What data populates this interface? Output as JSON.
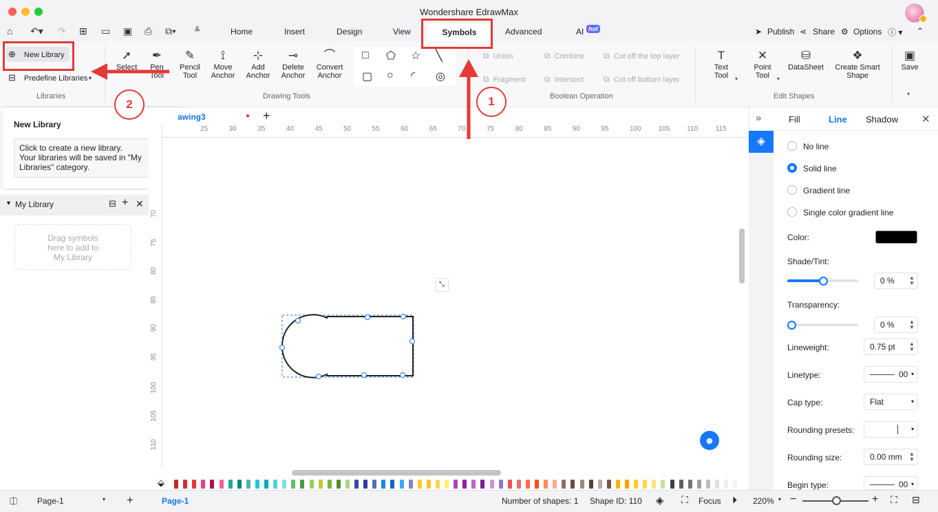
{
  "window": {
    "title": "Wondershare EdrawMax"
  },
  "menu": {
    "tabs": [
      "Home",
      "Insert",
      "Design",
      "View",
      "Symbols",
      "Advanced",
      "AI"
    ],
    "active_tab": "Symbols",
    "hot_badge": "hot",
    "right": {
      "publish": "Publish",
      "share": "Share",
      "options": "Options"
    }
  },
  "ribbon": {
    "libraries": {
      "new_library": "New Library",
      "predefine": "Predefine Libraries",
      "group_label": "Libraries"
    },
    "drawing_tools": {
      "select": "Select",
      "pen_line1": "Pen",
      "pen_line2": "Tool",
      "pencil_line1": "Pencil",
      "pencil_line2": "Tool",
      "move_line1": "Move",
      "move_line2": "Anchor",
      "add_line1": "Add",
      "add_line2": "Anchor",
      "delete_line1": "Delete",
      "delete_line2": "Anchor",
      "convert_line1": "Convert",
      "convert_line2": "Anchor",
      "group_label": "Drawing Tools"
    },
    "boolean": {
      "union": "Union",
      "combine": "Combine",
      "cut_top": "Cut off the top layer",
      "fragment": "Fragment",
      "intersect": "Intersect",
      "cut_bottom": "Cut off bottom layer",
      "group_label": "Boolean Operation"
    },
    "edit_shapes": {
      "text_line1": "Text",
      "text_line2": "Tool",
      "point_line1": "Point",
      "point_line2": "Tool",
      "datasheet": "DataSheet",
      "smart_line1": "Create Smart",
      "smart_line2": "Shape",
      "group_label": "Edit Shapes"
    },
    "save": "Save"
  },
  "popup": {
    "title": "New Library",
    "description": "Click to create a new library.\nYour libraries will be saved in \"My Libraries\" category."
  },
  "left_panel": {
    "my_library": "My Library",
    "drop_hint": "Drag symbols\nhere to add to\nMy Library"
  },
  "document": {
    "tab_name": "awing3"
  },
  "rulers": {
    "horizontal": [
      "25",
      "30",
      "35",
      "40",
      "45",
      "50",
      "55",
      "60",
      "65",
      "70",
      "75",
      "80",
      "85",
      "90",
      "95",
      "100",
      "105",
      "110",
      "115"
    ],
    "vertical": [
      "70",
      "75",
      "80",
      "85",
      "90",
      "95",
      "100",
      "105",
      "110"
    ]
  },
  "right_panel": {
    "tabs": {
      "fill": "Fill",
      "line": "Line",
      "shadow": "Shadow"
    },
    "active_tab": "Line",
    "line_options": [
      "No line",
      "Solid line",
      "Gradient line",
      "Single color gradient line"
    ],
    "selected_option": "Solid line",
    "color_label": "Color:",
    "color_value": "#000000",
    "shade_label": "Shade/Tint:",
    "shade_value": "0 %",
    "shade_fraction": 0.5,
    "transparency_label": "Transparency:",
    "transparency_value": "0 %",
    "transparency_fraction": 0.0,
    "lineweight_label": "Lineweight:",
    "lineweight_value": "0.75 pt",
    "linetype_label": "Linetype:",
    "linetype_value": "00",
    "cap_label": "Cap type:",
    "cap_value": "Flat",
    "rounding_presets_label": "Rounding presets:",
    "rounding_size_label": "Rounding size:",
    "rounding_size_value": "0.00 mm",
    "begin_type_label": "Begin type:",
    "begin_type_value": "00"
  },
  "status": {
    "page_select": "Page-1",
    "page_tab": "Page-1",
    "num_shapes": "Number of shapes: 1",
    "shape_id": "Shape ID: 110",
    "focus": "Focus",
    "zoom": "220%"
  },
  "annotations": {
    "step1": "1",
    "step2": "2"
  },
  "palette": [
    "#c62828",
    "#d32f2f",
    "#e53935",
    "#ec407a",
    "#ad1457",
    "#f06292",
    "#26a69a",
    "#00897b",
    "#4db6ac",
    "#26c6da",
    "#00acc1",
    "#4dd0e1",
    "#80deea",
    "#66bb6a",
    "#43a047",
    "#9ccc65",
    "#c0ca33",
    "#7cb342",
    "#558b2f",
    "#aed581",
    "#3949ab",
    "#303f9f",
    "#5c6bc0",
    "#1e88e5",
    "#1565c0",
    "#42a5f5",
    "#7986cb",
    "#ffca28",
    "#fbc02d",
    "#ffd54f",
    "#fff176",
    "#ab47bc",
    "#8e24aa",
    "#ba68c8",
    "#7b1fa2",
    "#ce93d8",
    "#9575cd",
    "#ef5350",
    "#e57373",
    "#ff7043",
    "#f4511e",
    "#ff8a65",
    "#ffab91",
    "#8d6e63",
    "#6d4c41",
    "#a1887f",
    "#5d4037",
    "#bcaaa4",
    "#795548",
    "#ffb300",
    "#ffa000",
    "#ffca28",
    "#ffd740",
    "#ffe082",
    "#c5e1a5",
    "#424242",
    "#616161",
    "#757575",
    "#9e9e9e",
    "#bdbdbd",
    "#e0e0e0",
    "#eeeeee",
    "#f5f5f5"
  ]
}
